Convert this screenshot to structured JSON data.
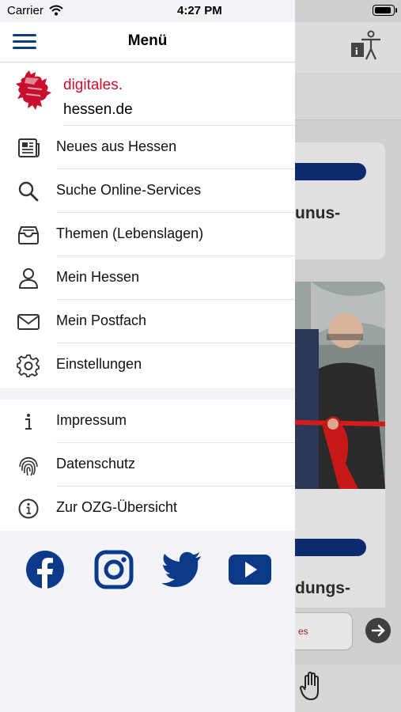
{
  "status_bar": {
    "carrier": "Carrier",
    "time": "4:27 PM"
  },
  "header": {
    "title": "Menü"
  },
  "logo": {
    "line1": "digitales.",
    "line2": "hessen.de"
  },
  "menu_main": [
    {
      "label": "Neues aus Hessen",
      "icon": "newspaper-icon"
    },
    {
      "label": "Suche Online-Services",
      "icon": "search-icon"
    },
    {
      "label": "Themen (Lebenslagen)",
      "icon": "inbox-tray-icon"
    },
    {
      "label": "Mein Hessen",
      "icon": "person-icon"
    },
    {
      "label": "Mein Postfach",
      "icon": "envelope-icon"
    },
    {
      "label": "Einstellungen",
      "icon": "gear-icon"
    }
  ],
  "menu_secondary": [
    {
      "label": "Impressum",
      "icon": "info-icon"
    },
    {
      "label": "Datenschutz",
      "icon": "fingerprint-icon"
    },
    {
      "label": "Zur OZG-Übersicht",
      "icon": "info-circle-icon"
    }
  ],
  "social": [
    "facebook-icon",
    "instagram-icon",
    "twitter-icon",
    "youtube-icon"
  ],
  "background": {
    "card1_text": "unus-",
    "card2_text": "dungs-",
    "search_text": "es"
  },
  "colors": {
    "brand_blue": "#0b3a8a",
    "brand_red": "#c8102e"
  }
}
